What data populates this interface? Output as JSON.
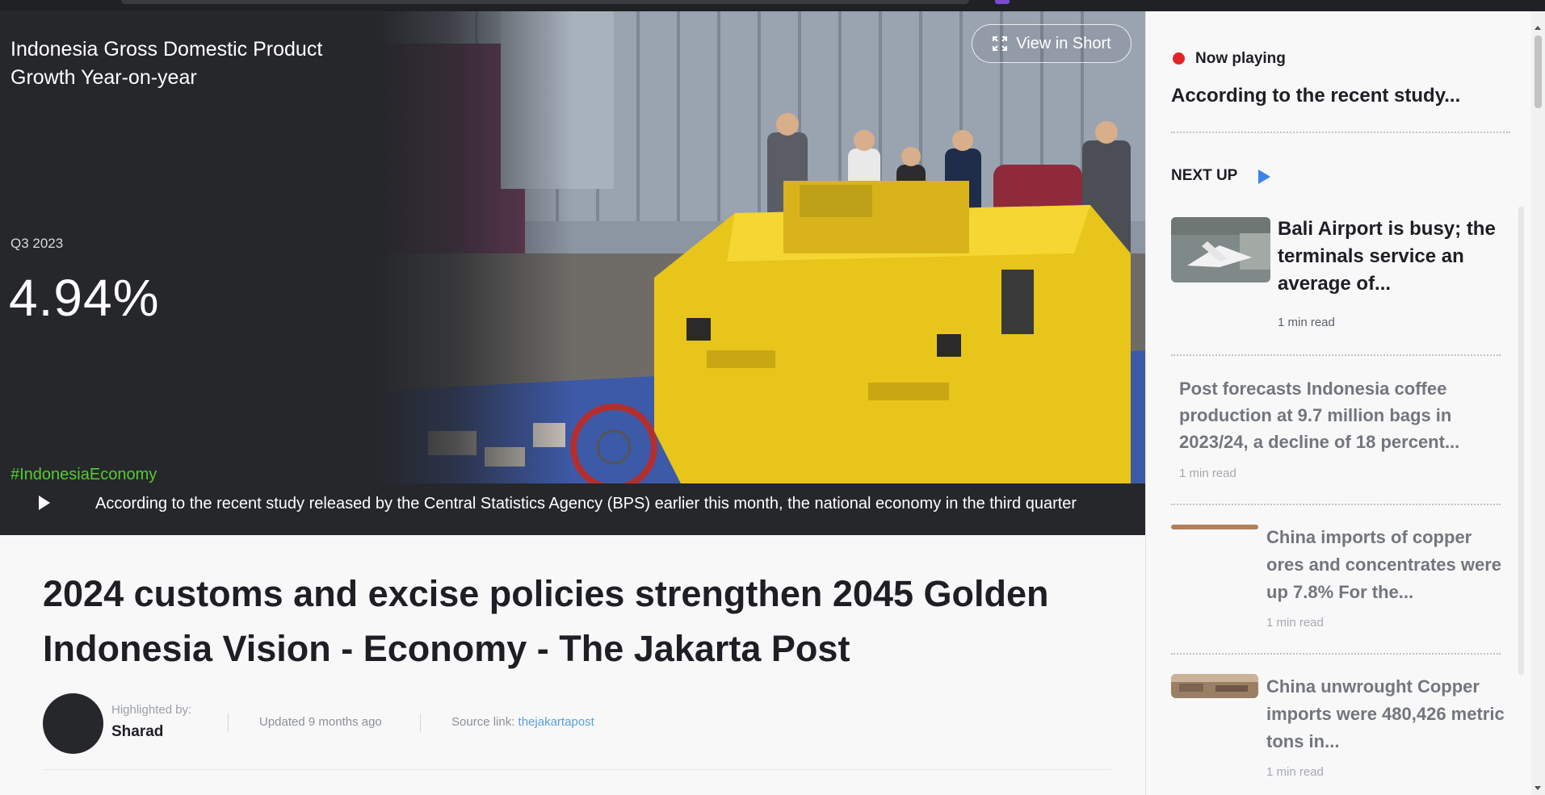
{
  "hero": {
    "title": "Indonesia Gross Domestic Product Growth Year-on-year",
    "period": "Q3 2023",
    "value": "4.94%",
    "hashtag": "#IndonesiaEconomy",
    "view_short_label": "View in Short",
    "ticker_text": "According to the recent study released by the Central Statistics Agency (BPS) earlier this month, the national economy in the third quarter"
  },
  "article": {
    "title": "2024 customs and excise policies strengthen 2045 Golden Indonesia Vision - Economy - The Jakarta Post",
    "highlighted_label": "Highlighted by:",
    "highlighted_name": "Sharad",
    "updated": "Updated 9 months ago",
    "source_label": "Source link:",
    "source_link": "thejakartapost"
  },
  "panel": {
    "now_playing_label": "Now playing",
    "now_playing_title": "According to the recent study...",
    "next_up_label": "NEXT UP",
    "items": [
      {
        "title": "Bali Airport is busy; the terminals service an average of...",
        "meta": "1 min read"
      },
      {
        "title": "Post forecasts Indonesia coffee production at 9.7 million bags in 2023/24, a decline of 18 percent...",
        "meta": "1 min read"
      },
      {
        "title": "China imports of copper ores and concentrates were up 7.8% For the...",
        "meta": "1 min read"
      },
      {
        "title": "China unwrought Copper imports were 480,426 metric tons in...",
        "meta": "1 min read"
      }
    ]
  },
  "colors": {
    "hero_bg": "#25272b",
    "hashtag": "#55cc2e",
    "now_playing_dot": "#e02424",
    "next_up_arrow": "#3f84e5",
    "link": "#5aa0d8"
  }
}
